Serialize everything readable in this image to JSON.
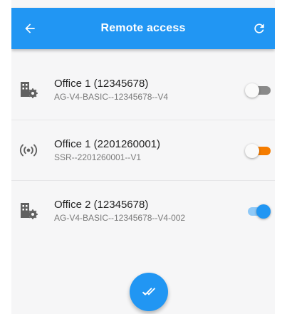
{
  "app": {
    "title": "Remote access"
  },
  "colors": {
    "primary": "#2196f3",
    "orange": "#f57c00",
    "off_gray": "#8a8a8a",
    "icon_gray": "#616161"
  },
  "icons": {
    "back": "arrow-left-icon",
    "refresh": "refresh-icon",
    "confirm": "double-check-icon"
  },
  "devices": [
    {
      "name": "Office 1 (12345678)",
      "id": "AG-V4-BASIC--12345678--V4",
      "icon": "building-gear-icon",
      "enabled": false,
      "accent": "gray"
    },
    {
      "name": "Office 1 (2201260001)",
      "id": "SSR--2201260001--V1",
      "icon": "broadcast-icon",
      "enabled": false,
      "accent": "orange"
    },
    {
      "name": "Office 2 (12345678)",
      "id": "AG-V4-BASIC--12345678--V4-002",
      "icon": "building-gear-icon",
      "enabled": true,
      "accent": "blue"
    }
  ]
}
